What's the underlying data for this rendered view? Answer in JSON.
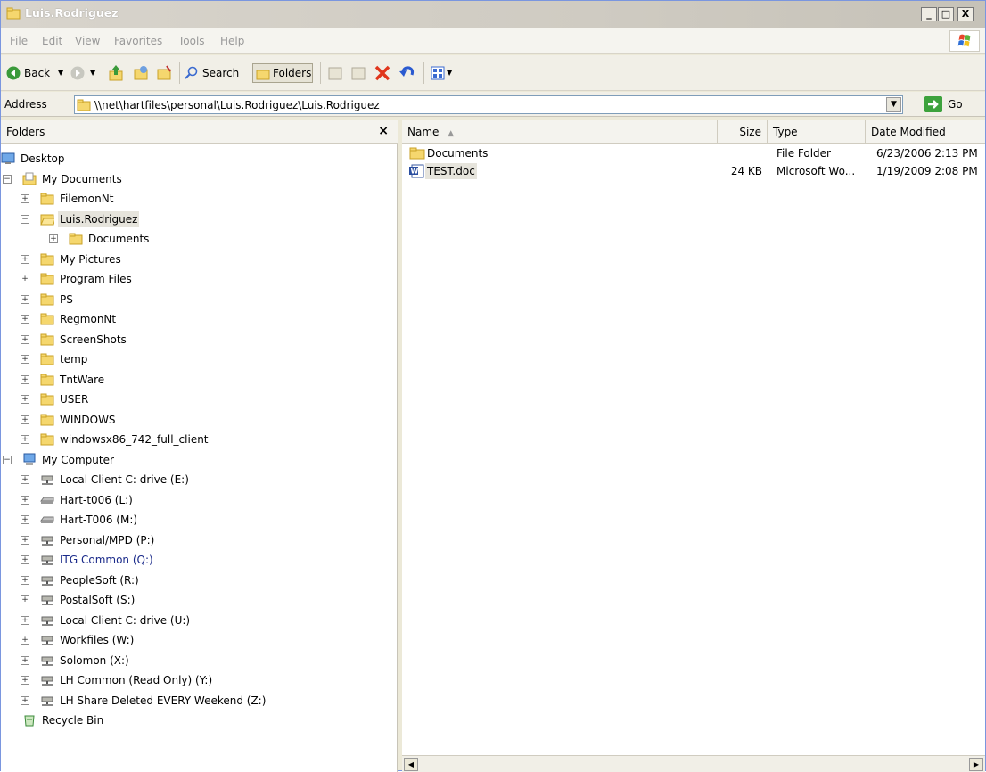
{
  "window": {
    "title": "Luis.Rodriguez",
    "min_label": "_",
    "max_label": "□",
    "close_label": "X"
  },
  "menu": {
    "items": [
      "File",
      "Edit",
      "View",
      "Favorites",
      "Tools",
      "Help"
    ]
  },
  "toolbar": {
    "back_label": "Back",
    "search_label": "Search",
    "folders_label": "Folders"
  },
  "address": {
    "label": "Address",
    "value": "\\\\net\\hartfiles\\personal\\Luis.Rodriguez\\Luis.Rodriguez",
    "go_label": "Go"
  },
  "folders_pane": {
    "title": "Folders",
    "close_label": "×",
    "tree": [
      {
        "label": "Desktop",
        "icon": "desktop-icon",
        "level": 0,
        "expander": ""
      },
      {
        "label": "My Documents",
        "icon": "my-documents-icon",
        "level": 1,
        "expander": "−"
      },
      {
        "label": "FilemonNt",
        "icon": "folder-icon",
        "level": 2,
        "expander": "+"
      },
      {
        "label": "Luis.Rodriguez",
        "icon": "folder-open-icon",
        "level": 2,
        "expander": "−",
        "selected": true
      },
      {
        "label": "Documents",
        "icon": "folder-icon",
        "level": 3,
        "expander": "+"
      },
      {
        "label": "My Pictures",
        "icon": "folder-icon",
        "level": 2,
        "expander": "+"
      },
      {
        "label": "Program Files",
        "icon": "folder-icon",
        "level": 2,
        "expander": "+"
      },
      {
        "label": "PS",
        "icon": "folder-icon",
        "level": 2,
        "expander": "+"
      },
      {
        "label": "RegmonNt",
        "icon": "folder-icon",
        "level": 2,
        "expander": "+"
      },
      {
        "label": "ScreenShots",
        "icon": "folder-icon",
        "level": 2,
        "expander": "+"
      },
      {
        "label": "temp",
        "icon": "folder-icon",
        "level": 2,
        "expander": "+"
      },
      {
        "label": "TntWare",
        "icon": "folder-icon",
        "level": 2,
        "expander": "+"
      },
      {
        "label": "USER",
        "icon": "folder-icon",
        "level": 2,
        "expander": "+"
      },
      {
        "label": "WINDOWS",
        "icon": "folder-icon",
        "level": 2,
        "expander": "+"
      },
      {
        "label": "windowsx86_742_full_client",
        "icon": "folder-icon",
        "level": 2,
        "expander": "+"
      },
      {
        "label": "My Computer",
        "icon": "my-computer-icon",
        "level": 1,
        "expander": "−"
      },
      {
        "label": "Local Client C: drive (E:)",
        "icon": "network-drive-icon",
        "level": 2,
        "expander": "+"
      },
      {
        "label": "Hart-t006 (L:)",
        "icon": "drive-icon",
        "level": 2,
        "expander": "+"
      },
      {
        "label": "Hart-T006 (M:)",
        "icon": "drive-icon",
        "level": 2,
        "expander": "+"
      },
      {
        "label": "Personal/MPD (P:)",
        "icon": "network-drive-icon",
        "level": 2,
        "expander": "+"
      },
      {
        "label": "ITG Common (Q:)",
        "icon": "network-drive-icon",
        "level": 2,
        "expander": "+",
        "blue": true
      },
      {
        "label": "PeopleSoft (R:)",
        "icon": "network-drive-icon",
        "level": 2,
        "expander": "+"
      },
      {
        "label": "PostalSoft (S:)",
        "icon": "network-drive-icon",
        "level": 2,
        "expander": "+"
      },
      {
        "label": "Local Client C: drive (U:)",
        "icon": "network-drive-icon",
        "level": 2,
        "expander": "+"
      },
      {
        "label": "Workfiles (W:)",
        "icon": "network-drive-icon",
        "level": 2,
        "expander": "+"
      },
      {
        "label": "Solomon (X:)",
        "icon": "network-drive-icon",
        "level": 2,
        "expander": "+"
      },
      {
        "label": "LH Common (Read Only) (Y:)",
        "icon": "network-drive-icon",
        "level": 2,
        "expander": "+"
      },
      {
        "label": "LH Share Deleted EVERY Weekend (Z:)",
        "icon": "network-drive-icon",
        "level": 2,
        "expander": "+"
      },
      {
        "label": "Recycle Bin",
        "icon": "recycle-bin-icon",
        "level": 1,
        "expander": ""
      }
    ]
  },
  "file_list": {
    "columns": [
      "Name",
      "Size",
      "Type",
      "Date Modified"
    ],
    "rows": [
      {
        "name": "Documents",
        "icon": "folder-icon",
        "size": "",
        "type": "File Folder",
        "modified": "6/23/2006 2:13 PM"
      },
      {
        "name": "TEST.doc",
        "icon": "word-doc-icon",
        "size": "24 KB",
        "type": "Microsoft Wo...",
        "modified": "1/19/2009 2:08 PM",
        "selected": true
      }
    ]
  },
  "colors": {
    "folder": "#f5d76e",
    "folder_edge": "#c9a227",
    "selection": "#e6e4dc",
    "blue_text": "#1a2a8a"
  }
}
